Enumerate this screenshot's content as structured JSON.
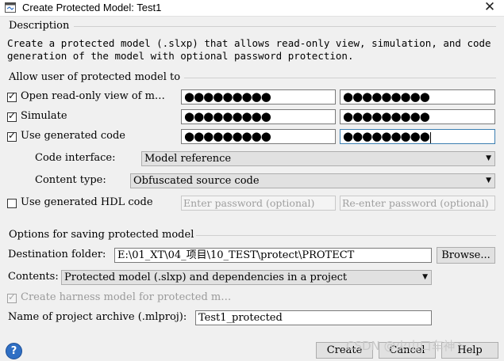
{
  "window": {
    "title": "Create Protected Model: Test1",
    "close_glyph": "✕"
  },
  "description": {
    "heading": "Description",
    "text": "Create a protected model (.slxp) that allows read-only view, simulation, and code generation of the model with optional password protection."
  },
  "allow": {
    "heading": "Allow user of protected model to",
    "options": [
      {
        "label": "Open read-only view of m…",
        "checked": true,
        "password": "●●●●●●●●●",
        "confirm": "●●●●●●●●●"
      },
      {
        "label": "Simulate",
        "checked": true,
        "password": "●●●●●●●●●",
        "confirm": "●●●●●●●●●"
      },
      {
        "label": "Use generated code",
        "checked": true,
        "password": "●●●●●●●●●",
        "confirm": "●●●●●●●●●"
      }
    ],
    "code_interface": {
      "label": "Code interface:",
      "value": "Model reference"
    },
    "content_type": {
      "label": "Content type:",
      "value": "Obfuscated source code"
    },
    "hdl": {
      "label": "Use generated HDL code",
      "checked": false,
      "password_placeholder": "Enter password (optional)",
      "confirm_placeholder": "Re-enter password (optional)"
    }
  },
  "saving": {
    "heading": "Options for saving protected model",
    "destination_label": "Destination folder:",
    "destination_value": "E:\\01_XT\\04_项目\\10_TEST\\protect\\PROTECT",
    "browse_label": "Browse...",
    "contents_label": "Contents:",
    "contents_value": "Protected model (.slxp) and dependencies in a project",
    "harness_label": "Create harness model for protected m…",
    "harness_checked": true,
    "archive_label": "Name of project archive (.mlproj):",
    "archive_value": "Test1_protected"
  },
  "footer": {
    "help_glyph": "?",
    "create_label": "Create",
    "cancel_label": "Cancel",
    "help_label": "Help"
  },
  "watermark": "CSDN @火山口车神丶",
  "colors": {
    "focus_border": "#3c7fb1",
    "help_blue": "#2f6fc4",
    "window_bg": "#f0f0f0"
  }
}
